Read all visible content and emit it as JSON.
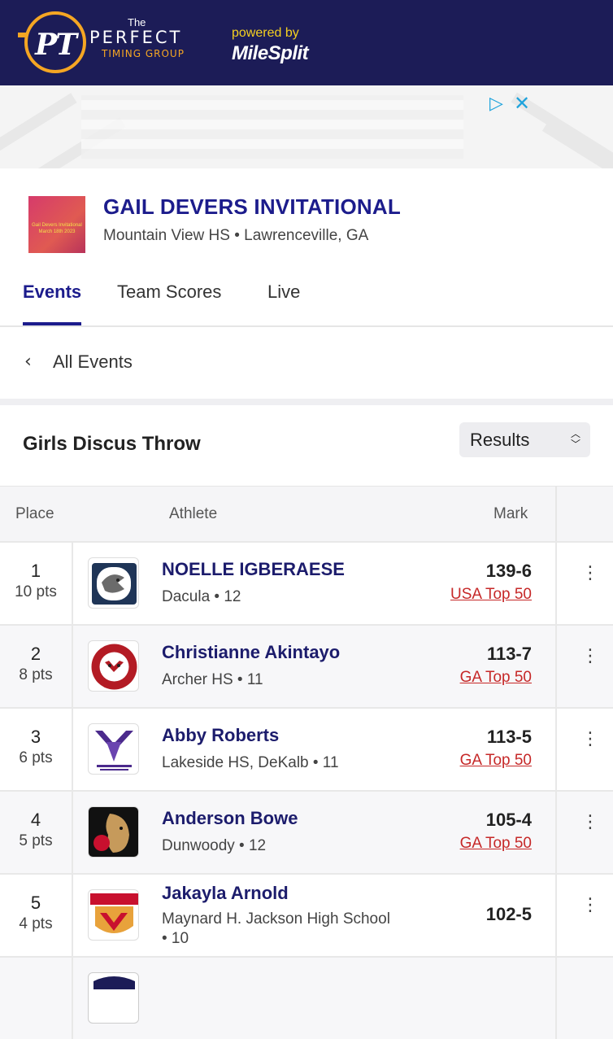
{
  "header": {
    "brand_the": "The",
    "brand_perfect": "PERFECT",
    "brand_timing": "TIMING GROUP",
    "brand_logo": "PT",
    "powered_by": "powered by",
    "partner": "MileSplit"
  },
  "ad": {
    "adchoices_icon": "adchoices-icon",
    "close_icon": "close-icon"
  },
  "meet": {
    "title": "GAIL DEVERS INVITATIONAL",
    "location": "Mountain View HS • Lawrenceville, GA",
    "thumb_text": "Gail Devers Invitational March 18th 2023"
  },
  "tabs": [
    {
      "label": "Events",
      "active": true
    },
    {
      "label": "Team Scores",
      "active": false
    },
    {
      "label": "Live",
      "active": false
    }
  ],
  "back": {
    "label": "All Events",
    "icon": "chevron-left-icon"
  },
  "event": {
    "title": "Girls Discus Throw",
    "view_select": "Results"
  },
  "table": {
    "headers": {
      "place": "Place",
      "athlete": "Athlete",
      "mark": "Mark"
    },
    "rows": [
      {
        "place": "1",
        "pts": "10 pts",
        "name": "NOELLE IGBERAESE",
        "team": "Dacula • 12",
        "mark": "139-6",
        "rank": "USA Top 50",
        "logo": "dacula-logo"
      },
      {
        "place": "2",
        "pts": "8 pts",
        "name": "Christianne Akintayo",
        "team": "Archer HS • 11",
        "mark": "113-7",
        "rank": "GA Top 50",
        "logo": "archer-logo"
      },
      {
        "place": "3",
        "pts": "6 pts",
        "name": "Abby Roberts",
        "team": "Lakeside HS, DeKalb • 11",
        "mark": "113-5",
        "rank": "GA Top 50",
        "logo": "lakeside-logo"
      },
      {
        "place": "4",
        "pts": "5 pts",
        "name": "Anderson Bowe",
        "team": "Dunwoody • 12",
        "mark": "105-4",
        "rank": "GA Top 50",
        "logo": "dunwoody-logo"
      },
      {
        "place": "5",
        "pts": "4 pts",
        "name": "Jakayla Arnold",
        "team": "Maynard H. Jackson High School • 10",
        "mark": "102-5",
        "rank": "",
        "logo": "maynard-logo"
      }
    ]
  },
  "colors": {
    "navy": "#1c1c57",
    "brand_blue": "#1c1c8c",
    "accent_orange": "#f5a623",
    "link_red": "#c62828"
  }
}
